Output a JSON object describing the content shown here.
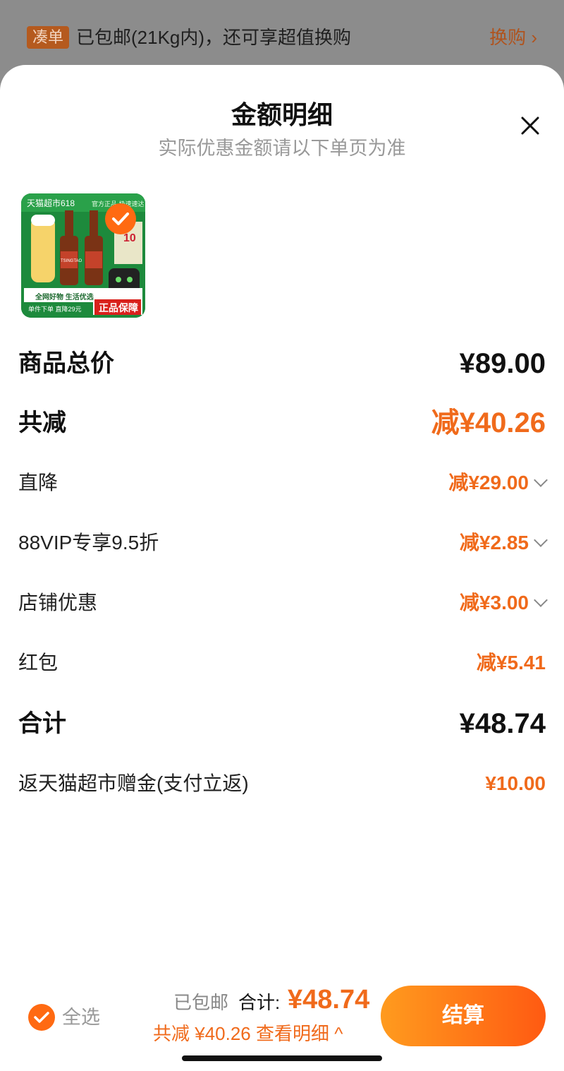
{
  "top_banner": {
    "tag": "凑单",
    "message": "已包邮(21Kg内)，还可享超值换购",
    "swap_label": "换购",
    "swap_chevron": "›"
  },
  "sheet": {
    "title": "金额明细",
    "subtitle": "实际优惠金额请以下单页为准"
  },
  "product": {
    "banner_text": "天猫超市618",
    "banner_text_right": "官方正品 极速速达",
    "promo_lines": [
      "全网好物 生活优选",
      "单件下单 直降29元"
    ],
    "badge": "正品保障",
    "brand_text": "TSINGTAO"
  },
  "rows": [
    {
      "label": "商品总价",
      "value": "¥89.00"
    },
    {
      "label": "共减",
      "value": "减¥40.26"
    },
    {
      "label": "直降",
      "value": "减¥29.00"
    },
    {
      "label": "88VIP专享9.5折",
      "value": "减¥2.85"
    },
    {
      "label": "店铺优惠",
      "value": "减¥3.00"
    },
    {
      "label": "红包",
      "value": "减¥5.41"
    },
    {
      "label": "合计",
      "value": "¥48.74"
    },
    {
      "label": "返天猫超市赠金(支付立返)",
      "value": "¥10.00"
    }
  ],
  "footer": {
    "select_all": "全选",
    "shipping": "已包邮",
    "total_label": "合计:",
    "total_value": "¥48.74",
    "discount_summary": "共减 ¥40.26",
    "view_details": "查看明细",
    "view_details_chevron": "^",
    "checkout": "结算"
  },
  "colors": {
    "accent": "#f06a1b",
    "tag_bg": "#b55a1e",
    "checkout_gradient_start": "#ff9b1e",
    "checkout_gradient_end": "#ff5a12"
  }
}
